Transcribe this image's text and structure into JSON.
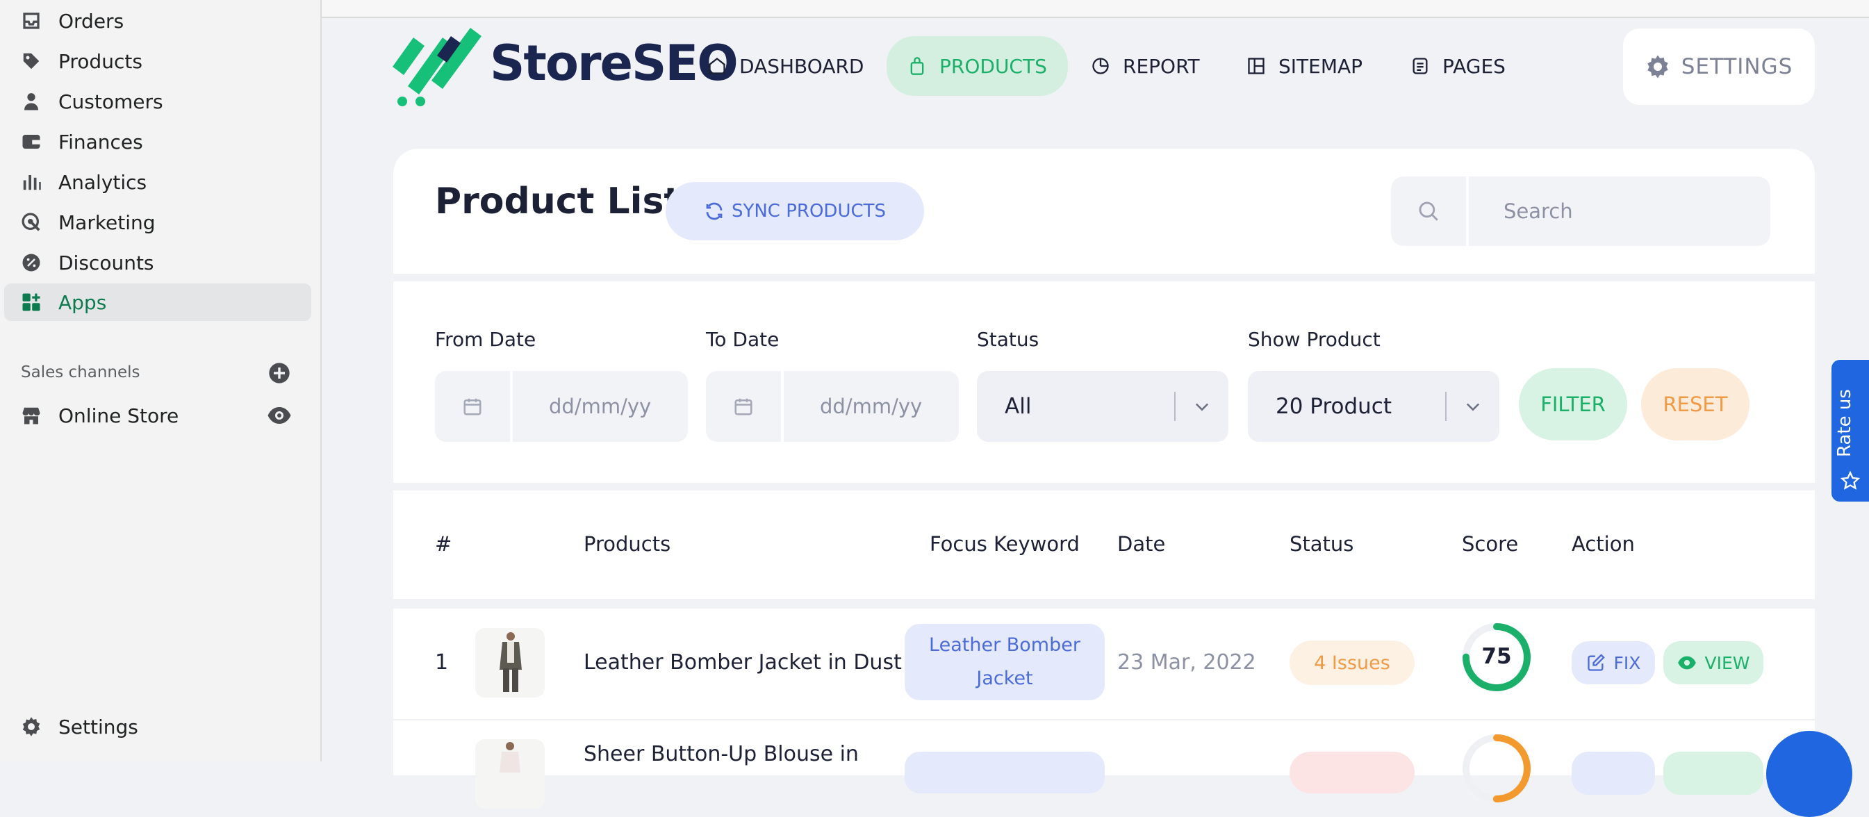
{
  "sidebar": {
    "items": [
      {
        "label": "Orders",
        "icon": "orders-icon"
      },
      {
        "label": "Products",
        "icon": "tag-icon"
      },
      {
        "label": "Customers",
        "icon": "person-icon"
      },
      {
        "label": "Finances",
        "icon": "wallet-icon"
      },
      {
        "label": "Analytics",
        "icon": "bar-chart-icon"
      },
      {
        "label": "Marketing",
        "icon": "target-icon"
      },
      {
        "label": "Discounts",
        "icon": "discount-icon"
      },
      {
        "label": "Apps",
        "icon": "apps-icon",
        "active": true
      }
    ],
    "sales_channels_label": "Sales channels",
    "online_store_label": "Online Store",
    "settings_label": "Settings"
  },
  "app": {
    "brand": "StoreSEO",
    "nav": [
      {
        "label": "DASHBOARD",
        "icon": "home-icon"
      },
      {
        "label": "PRODUCTS",
        "icon": "bag-icon",
        "active": true
      },
      {
        "label": "REPORT",
        "icon": "report-icon"
      },
      {
        "label": "SITEMAP",
        "icon": "sitemap-icon"
      },
      {
        "label": "PAGES",
        "icon": "pages-icon"
      }
    ],
    "settings_label": "SETTINGS"
  },
  "product_list": {
    "title": "Product List",
    "sync_label": "SYNC PRODUCTS",
    "search_placeholder": "Search"
  },
  "filters": {
    "from_date_label": "From Date",
    "from_date_placeholder": "dd/mm/yy",
    "to_date_label": "To Date",
    "to_date_placeholder": "dd/mm/yy",
    "status_label": "Status",
    "status_value": "All",
    "show_product_label": "Show Product",
    "show_product_value": "20 Product",
    "filter_label": "FILTER",
    "reset_label": "RESET"
  },
  "table": {
    "headers": [
      "#",
      "Products",
      "Focus Keyword",
      "Date",
      "Status",
      "Score",
      "Action"
    ],
    "rows": [
      {
        "num": "1",
        "product": "Leather Bomber Jacket in Dust",
        "keyword_line1": "Leather Bomber",
        "keyword_line2": "Jacket",
        "date": "23 Mar, 2022",
        "status": "4 Issues",
        "score": 75,
        "score_label": "75",
        "fix_label": "FIX",
        "view_label": "VIEW"
      },
      {
        "num": "",
        "product": "Sheer Button-Up Blouse in",
        "score": 50
      }
    ]
  },
  "rate_us_label": "Rate us",
  "colors": {
    "accent_green": "#1bb069",
    "accent_blue": "#4b6cd8",
    "warning_orange": "#ef9a45",
    "brand_navy": "#1a2550"
  }
}
